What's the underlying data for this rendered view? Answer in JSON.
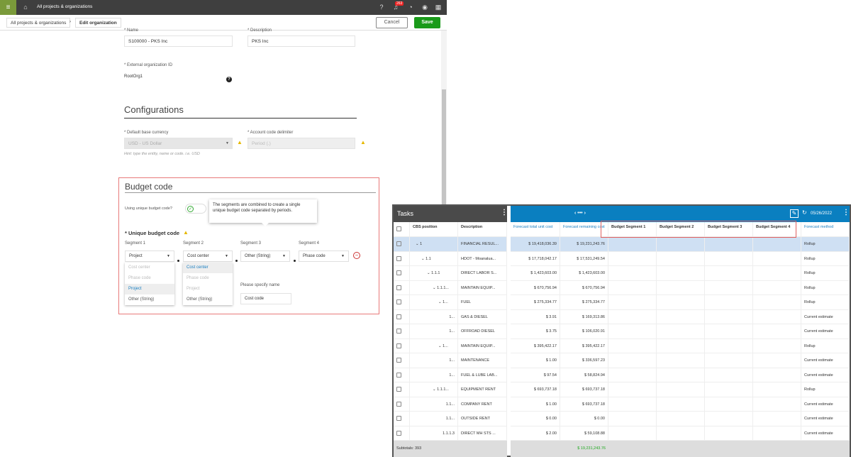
{
  "topbar": {
    "title": "All projects & organizations",
    "notification_count": "263",
    "icons": [
      "menu-icon",
      "home-icon",
      "help-icon",
      "bell-icon",
      "clock-icon",
      "user-icon",
      "apps-icon"
    ]
  },
  "breadcrumb": {
    "items": [
      "All projects & organizations",
      "Edit organization"
    ]
  },
  "actions": {
    "cancel": "Cancel",
    "save": "Save",
    "save_color": "#1a9a1a"
  },
  "form": {
    "name_label": "* Name",
    "name_value": "S100000 - PKS Inc",
    "desc_label": "* Description",
    "desc_value": "PKS Inc",
    "ext_label": "* External organization ID",
    "ext_value": "RootOrg1"
  },
  "config": {
    "title": "Configurations",
    "currency_label": "* Default base currency",
    "currency_value": "USD - US Dollar",
    "delim_label": "* Account code delimiter",
    "delim_value": "Period (.)",
    "hint": "Hint: type the entity, name or code. i.e. USD"
  },
  "budget": {
    "title": "Budget code",
    "toggle_label": "Using unique budget code?",
    "toggle_on": true,
    "tooltip": "The segments are combined to create a single unique budget code separated by periods.",
    "unique_label": "* Unique budget code",
    "segments": [
      {
        "label": "Segment 1",
        "value": "Project"
      },
      {
        "label": "Segment 2",
        "value": "Cost center"
      },
      {
        "label": "Segment 3",
        "value": "Other (String)"
      },
      {
        "label": "Segment 4",
        "value": "Phase code"
      }
    ],
    "menu1": [
      "Cost center",
      "Phase code",
      "Project",
      "Other (String)"
    ],
    "menu2": [
      "Cost center",
      "Phase code",
      "Project",
      "Other (String)"
    ],
    "specify_label": "Please specify name",
    "specify_value": "Cost code"
  },
  "grid": {
    "panel_title": "Tasks",
    "nav": "‹ ••• ›",
    "date": "05/26/2022",
    "left_headers": [
      "CBS position",
      "Description"
    ],
    "right_headers": [
      "Forecast total unit cost",
      "Forecast remaining cost",
      "Budget Segment 1",
      "Budget Segment 2",
      "Budget Segment 3",
      "Budget Segment 4",
      "Forecast method"
    ],
    "rows": [
      {
        "cbs": "1",
        "desc": "FINANCIAL RESUL...",
        "total": "$ 19,418,036.39",
        "remaining": "$ 19,231,243.76",
        "method": "Rollup",
        "exp": true,
        "lvl": 0
      },
      {
        "cbs": "1.1",
        "desc": "HDOT - Moanalua...",
        "total": "$ 17,718,042.17",
        "remaining": "$ 17,531,249.54",
        "method": "Rollup",
        "exp": true,
        "lvl": 1
      },
      {
        "cbs": "1.1.1",
        "desc": "DIRECT LABOR S...",
        "total": "$ 1,423,603.00",
        "remaining": "$ 1,423,603.00",
        "method": "Rollup",
        "exp": true,
        "lvl": 2
      },
      {
        "cbs": "1.1.1...",
        "desc": "MAINTAIN EQUIP...",
        "total": "$ 670,756.94",
        "remaining": "$ 670,756.94",
        "method": "Rollup",
        "exp": true,
        "lvl": 3
      },
      {
        "cbs": "1...",
        "desc": "FUEL",
        "total": "$ 275,334.77",
        "remaining": "$ 275,334.77",
        "method": "Rollup",
        "exp": true,
        "lvl": 4
      },
      {
        "cbs": "1...",
        "desc": "GAS & DIESEL",
        "total": "$ 3.91",
        "remaining": "$ 169,313.86",
        "method": "Current estimate",
        "exp": false,
        "lvl": 5
      },
      {
        "cbs": "1...",
        "desc": "OFFROAD DIESEL",
        "total": "$ 3.75",
        "remaining": "$ 106,020.91",
        "method": "Current estimate",
        "exp": false,
        "lvl": 5
      },
      {
        "cbs": "1...",
        "desc": "MAINTAIN EQUIP...",
        "total": "$ 395,422.17",
        "remaining": "$ 395,422.17",
        "method": "Rollup",
        "exp": true,
        "lvl": 4
      },
      {
        "cbs": "1...",
        "desc": "MAINTENANCE",
        "total": "$ 1.00",
        "remaining": "$ 336,597.23",
        "method": "Current estimate",
        "exp": false,
        "lvl": 5
      },
      {
        "cbs": "1...",
        "desc": "FUEL & LUBE LAB...",
        "total": "$ 97.54",
        "remaining": "$ 58,824.94",
        "method": "Current estimate",
        "exp": false,
        "lvl": 5
      },
      {
        "cbs": "1.1.1...",
        "desc": "EQUIPMENT RENT",
        "total": "$ 693,737.18",
        "remaining": "$ 693,737.18",
        "method": "Rollup",
        "exp": true,
        "lvl": 3
      },
      {
        "cbs": "1.1...",
        "desc": "COMPANY RENT",
        "total": "$ 1.00",
        "remaining": "$ 693,737.18",
        "method": "Current estimate",
        "exp": false,
        "lvl": 4
      },
      {
        "cbs": "1.1...",
        "desc": "OUTSIDE RENT",
        "total": "$ 0.00",
        "remaining": "$ 0.00",
        "method": "Current estimate",
        "exp": false,
        "lvl": 4
      },
      {
        "cbs": "1.1.1.3",
        "desc": "DIRECT MH STS ...",
        "total": "$ 2.00",
        "remaining": "$ 59,108.88",
        "method": "Current estimate",
        "exp": false,
        "lvl": 3
      }
    ],
    "subtotal_label": "Subtotals: 393",
    "subtotal_value": "$ 19,231,243.76",
    "header_color": "#0a7fc0",
    "selected_row_color": "#cfe0f3"
  }
}
